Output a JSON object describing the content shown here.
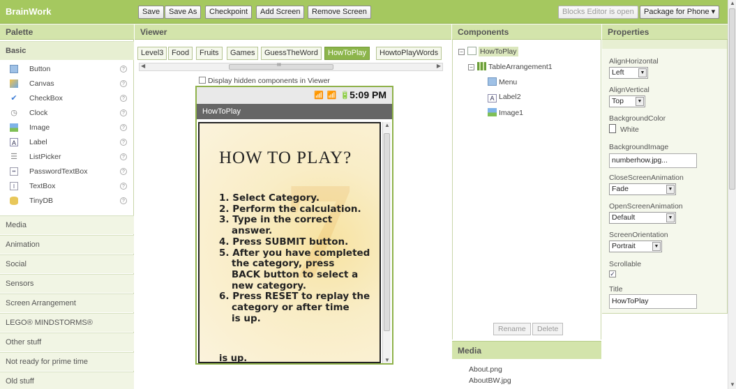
{
  "app": {
    "brand": "BrainWork"
  },
  "toolbar": {
    "save": "Save",
    "save_as": "Save As",
    "checkpoint": "Checkpoint",
    "add_screen": "Add Screen",
    "remove_screen": "Remove Screen",
    "blocks_editor": "Blocks Editor is open",
    "package": "Package for Phone ▾"
  },
  "palette": {
    "title": "Palette",
    "basic": "Basic",
    "items": [
      {
        "label": "Button",
        "icon": "button-icon"
      },
      {
        "label": "Canvas",
        "icon": "canvas-icon"
      },
      {
        "label": "CheckBox",
        "icon": "checkbox-icon"
      },
      {
        "label": "Clock",
        "icon": "clock-icon"
      },
      {
        "label": "Image",
        "icon": "image-icon"
      },
      {
        "label": "Label",
        "icon": "label-icon"
      },
      {
        "label": "ListPicker",
        "icon": "listpicker-icon"
      },
      {
        "label": "PasswordTextBox",
        "icon": "password-icon"
      },
      {
        "label": "TextBox",
        "icon": "textbox-icon"
      },
      {
        "label": "TinyDB",
        "icon": "database-icon"
      }
    ],
    "help": "?",
    "categories": [
      "Media",
      "Animation",
      "Social",
      "Sensors",
      "Screen Arrangement",
      "LEGO® MINDSTORMS®",
      "Other stuff",
      "Not ready for prime time",
      "Old stuff"
    ]
  },
  "viewer": {
    "title": "Viewer",
    "tabs": [
      "Level3",
      "Food",
      "Fruits",
      "Games",
      "GuessTheWord",
      "HowToPlay",
      "HowtoPlayWords"
    ],
    "active_tab": "HowToPlay",
    "scroll_mark": "III",
    "hidden_label": "Display hidden components in Viewer",
    "phone": {
      "status_icons": "📶 📶 🔋",
      "time": "5:09 PM",
      "screen_title": "HowToPlay",
      "heading": "HOW TO PLAY?",
      "steps": [
        "1. Select Category.",
        "2. Perform the calculation.",
        "3. Type in the correct",
        "answer.",
        "4. Press SUBMIT button.",
        "5. After you have completed",
        "the category, press",
        "BACK button to select a",
        "new category.",
        "6. Press RESET to replay the",
        "category or after time",
        "is up."
      ],
      "tail": "is up.",
      "deco": "7"
    }
  },
  "components": {
    "title": "Components",
    "tree": {
      "root": "HowToPlay",
      "table": "TableArrangement1",
      "children": [
        "Menu",
        "Label2",
        "Image1"
      ]
    },
    "rename": "Rename",
    "delete": "Delete"
  },
  "media": {
    "title": "Media",
    "files": [
      "About.png",
      "AboutBW.jpg"
    ]
  },
  "properties": {
    "title": "Properties",
    "align_h_label": "AlignHorizontal",
    "align_h": "Left",
    "align_v_label": "AlignVertical",
    "align_v": "Top",
    "bg_color_label": "BackgroundColor",
    "bg_color": "White",
    "bg_image_label": "BackgroundImage",
    "bg_image": "numberhow.jpg...",
    "close_anim_label": "CloseScreenAnimation",
    "close_anim": "Fade",
    "open_anim_label": "OpenScreenAnimation",
    "open_anim": "Default",
    "orientation_label": "ScreenOrientation",
    "orientation": "Portrait",
    "scrollable_label": "Scrollable",
    "scrollable_mark": "✓",
    "title_label": "Title",
    "title_value": "HowToPlay"
  }
}
